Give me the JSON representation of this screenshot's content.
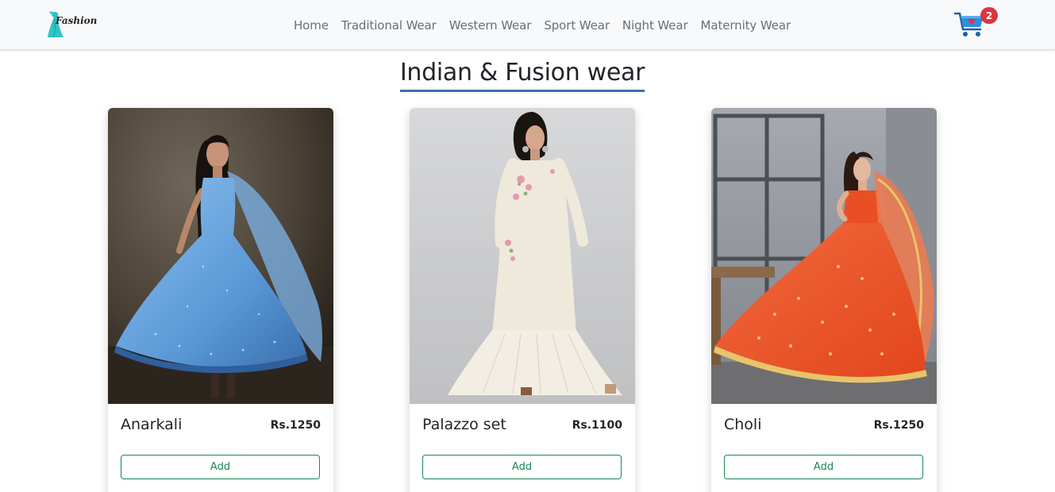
{
  "brand": {
    "name": "Fashion",
    "logo_icon": "dress-logo-icon",
    "accent": "#2ec4c6"
  },
  "nav": {
    "items": [
      {
        "label": "Home"
      },
      {
        "label": "Traditional Wear"
      },
      {
        "label": "Western Wear"
      },
      {
        "label": "Sport Wear"
      },
      {
        "label": "Night Wear"
      },
      {
        "label": "Maternity Wear"
      }
    ]
  },
  "cart": {
    "icon": "shopping-cart-icon",
    "count": "2",
    "badge_color": "#dc3545"
  },
  "page": {
    "title": "Indian & Fusion wear"
  },
  "products": [
    {
      "name": "Anarkali",
      "price": "Rs.1250",
      "button": "Add",
      "image": "woman-in-blue-anarkali-photo"
    },
    {
      "name": "Palazzo set",
      "price": "Rs.1100",
      "button": "Add",
      "image": "woman-in-white-palazzo-set-photo"
    },
    {
      "name": "Choli",
      "price": "Rs.1250",
      "button": "Add",
      "image": "woman-in-orange-choli-photo"
    }
  ],
  "colors": {
    "button_outline": "#198754",
    "title_underline": "#3a6fb0"
  }
}
